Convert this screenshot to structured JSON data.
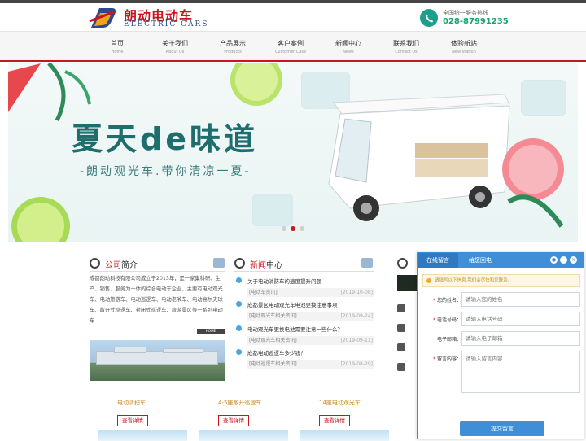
{
  "header": {
    "logo_cn": "朗动电动车",
    "logo_en": "ELECTRIC CARS",
    "hotline_label": "全国统一服务热线",
    "hotline_number": "028-87991235"
  },
  "nav": [
    {
      "cn": "首页",
      "en": "Home"
    },
    {
      "cn": "关于我们",
      "en": "About Us"
    },
    {
      "cn": "产品展示",
      "en": "Products"
    },
    {
      "cn": "客户案例",
      "en": "Customer Case"
    },
    {
      "cn": "新闻中心",
      "en": "News"
    },
    {
      "cn": "联系我们",
      "en": "Contact Us"
    },
    {
      "cn": "体验新站",
      "en": "New station"
    }
  ],
  "banner": {
    "title": "夏天de味道",
    "subtitle": "-朗动观光车.带你清凉一夏-",
    "active_slide": 2,
    "slide_count": 3
  },
  "about": {
    "title_red": "公司",
    "title_rest": "简介",
    "text": "成都朗动科技有限公司成立于2013年，是一家集科研、生产、销售、服务为一体的综合电动车企业，主要有电动观光车、电动旅游车、电动巡逻车、电动老爷车、电动高尔夫球车、敞开式巡逻车、封闭式巡逻车、旅游景区等一系列电动车",
    "home_tag": "HOME"
  },
  "news": {
    "title_red": "新闻",
    "title_rest": "中心",
    "items": [
      {
        "title": "关于电动消防车的速度提升问题",
        "category": "[电动车资讯]",
        "date": "[2019-10-08]"
      },
      {
        "title": "成都景区电动观光车电池更换注意事项",
        "category": "[电动观光车相关资讯]",
        "date": "[2019-09-24]"
      },
      {
        "title": "电动观光车更换电池需要注意一些什么？",
        "category": "[电动观光车相关资讯]",
        "date": "[2019-09-11]"
      },
      {
        "title": "成都电动巡逻车多少钱？",
        "category": "[电动巡逻车相关资讯]",
        "date": "[2019-08-29]"
      }
    ]
  },
  "products": [
    {
      "name": "电动清扫车",
      "button": "查看详情"
    },
    {
      "name": "4-5座敞开巡逻车",
      "button": "查看详情"
    },
    {
      "name": "14座电动观光车",
      "button": "查看详情"
    }
  ],
  "chat": {
    "tab_active": "在线留言",
    "tab_inactive": "给您回电",
    "notice": "请填写以下信息,我们会尽快和您联系。",
    "fields": [
      {
        "label": "您的姓名：",
        "placeholder": "请输入您的姓名"
      },
      {
        "label": "电话号码：",
        "placeholder": "请输入电话号码"
      },
      {
        "label": "电子邮箱：",
        "placeholder": "请输入电子邮箱"
      },
      {
        "label": "留言内容：",
        "placeholder": "请输入留言内容"
      }
    ],
    "submit": "提交留言"
  },
  "colors": {
    "brand_red": "#c9151e",
    "hotline_green": "#18a370",
    "chat_blue": "#3f8ed8"
  }
}
